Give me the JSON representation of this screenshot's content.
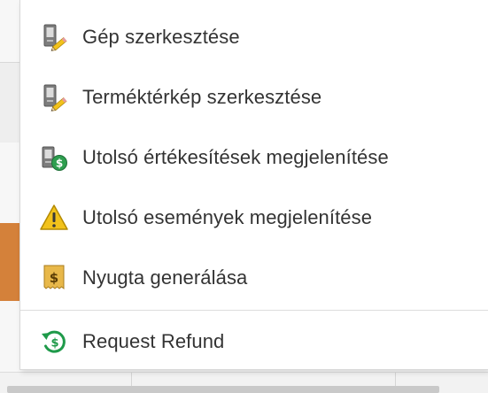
{
  "menu": {
    "items": [
      {
        "label": "Gép szerkesztése",
        "icon": "machine-edit-icon"
      },
      {
        "label": "Terméktérkép szerkesztése",
        "icon": "product-map-edit-icon"
      },
      {
        "label": "Utolsó értékesítések megjelenítése",
        "icon": "recent-sales-icon"
      },
      {
        "label": "Utolsó események megjelenítése",
        "icon": "warning-icon"
      },
      {
        "label": "Nyugta generálása",
        "icon": "receipt-icon"
      }
    ],
    "footer_item": {
      "label": "Request Refund",
      "icon": "refund-icon"
    }
  },
  "colors": {
    "accent_orange": "#d4813a",
    "warning_yellow": "#f2c21b",
    "money_green": "#2e9e4f",
    "receipt_gold": "#e8b84a",
    "refund_green": "#1f9a4a"
  }
}
